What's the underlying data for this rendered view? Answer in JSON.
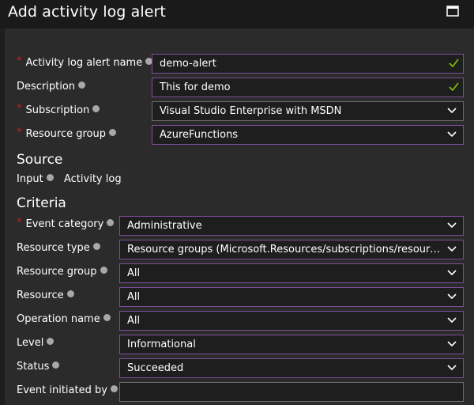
{
  "header": {
    "title": "Add activity log alert"
  },
  "fields": {
    "alert_name": {
      "label": "Activity log alert name",
      "value": "demo-alert",
      "required": true
    },
    "description": {
      "label": "Description",
      "value": "This for demo"
    },
    "subscription": {
      "label": "Subscription",
      "value": "Visual Studio Enterprise with MSDN",
      "required": true
    },
    "resource_group": {
      "label": "Resource group",
      "value": "AzureFunctions",
      "required": true
    }
  },
  "source": {
    "heading": "Source",
    "input_label": "Input",
    "input_value": "Activity log"
  },
  "criteria": {
    "heading": "Criteria",
    "event_category": {
      "label": "Event category",
      "value": "Administrative",
      "required": true
    },
    "resource_type": {
      "label": "Resource type",
      "value": "Resource groups (Microsoft.Resources/subscriptions/resourceGr..."
    },
    "resource_group": {
      "label": "Resource group",
      "value": "All"
    },
    "resource": {
      "label": "Resource",
      "value": "All"
    },
    "operation_name": {
      "label": "Operation name",
      "value": "All"
    },
    "level": {
      "label": "Level",
      "value": "Informational"
    },
    "status": {
      "label": "Status",
      "value": "Succeeded"
    },
    "event_initiated_by": {
      "label": "Event initiated by",
      "value": ""
    }
  },
  "icons": {
    "maximize": "maximize-icon",
    "info": "info-icon",
    "chevron": "chevron-down-icon",
    "check": "checkmark-icon"
  },
  "colors": {
    "accent_border": "#7e4e9a",
    "required": "#e81123",
    "valid_check": "#7fba00",
    "panel": "#2b2b2b",
    "header": "#1a1a1a"
  }
}
